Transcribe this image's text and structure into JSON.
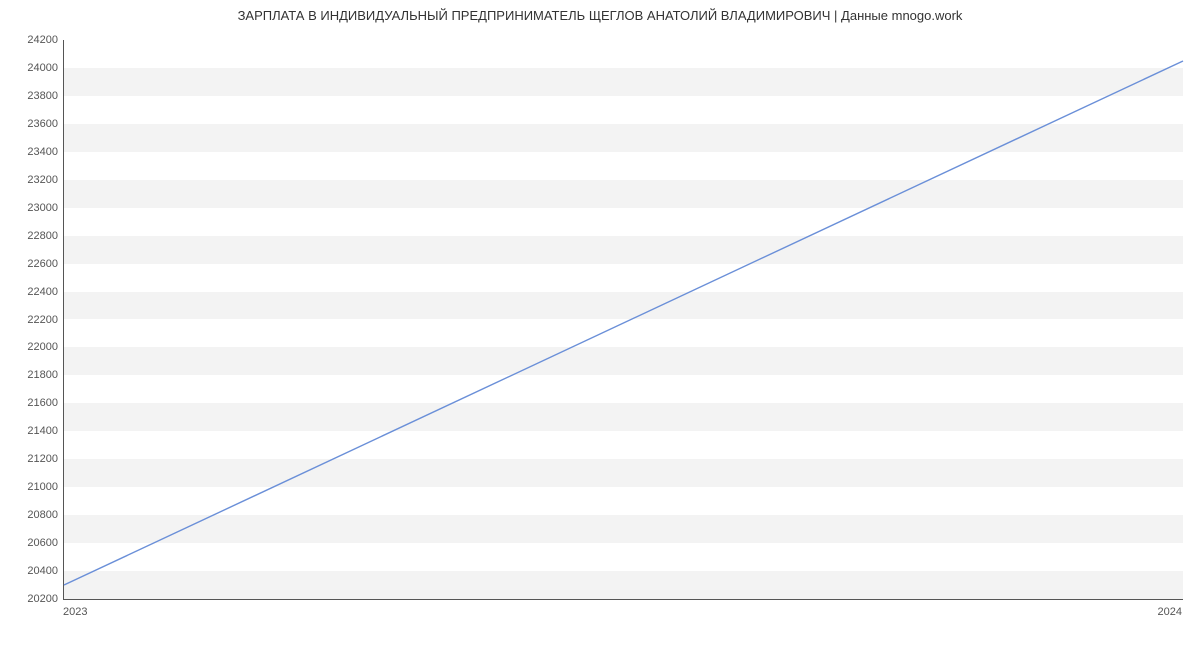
{
  "chart_data": {
    "type": "line",
    "title": "ЗАРПЛАТА В ИНДИВИДУАЛЬНЫЙ ПРЕДПРИНИМАТЕЛЬ ЩЕГЛОВ АНАТОЛИЙ ВЛАДИМИРОВИЧ | Данные mnogo.work",
    "xlabel": "",
    "ylabel": "",
    "x": [
      2023,
      2024
    ],
    "x_tick_labels": [
      "2023",
      "2024"
    ],
    "y_ticks": [
      20200,
      20400,
      20600,
      20800,
      21000,
      21200,
      21400,
      21600,
      21800,
      22000,
      22200,
      22400,
      22600,
      22800,
      23000,
      23200,
      23400,
      23600,
      23800,
      24000,
      24200
    ],
    "ylim": [
      20200,
      24200
    ],
    "series": [
      {
        "name": "salary",
        "x": [
          2023,
          2024
        ],
        "y": [
          20300,
          24050
        ]
      }
    ],
    "line_color": "#6a8fd8",
    "grid": true
  }
}
